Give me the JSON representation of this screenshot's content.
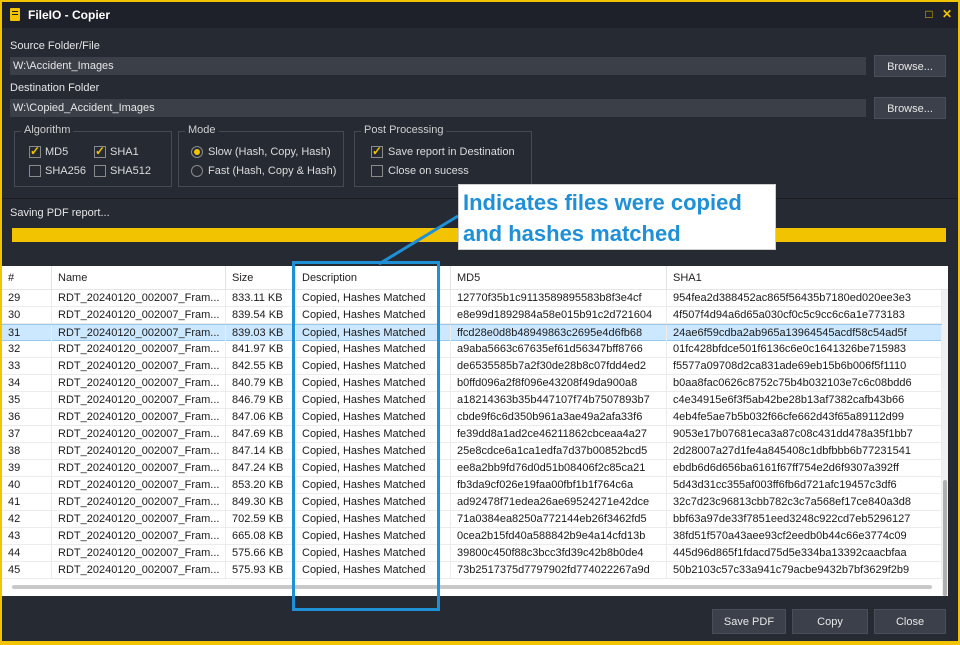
{
  "window": {
    "title": "FileIO - Copier"
  },
  "source": {
    "label": "Source Folder/File",
    "value": "W:\\Accident_Images",
    "browse_label": "Browse..."
  },
  "destination": {
    "label": "Destination Folder",
    "value": "W:\\Copied_Accident_Images",
    "browse_label": "Browse..."
  },
  "algorithm": {
    "title": "Algorithm",
    "options": [
      {
        "label": "MD5",
        "checked": true
      },
      {
        "label": "SHA1",
        "checked": true
      },
      {
        "label": "SHA256",
        "checked": false
      },
      {
        "label": "SHA512",
        "checked": false
      }
    ]
  },
  "mode": {
    "title": "Mode",
    "options": [
      {
        "label": "Slow (Hash, Copy, Hash)",
        "selected": true
      },
      {
        "label": "Fast (Hash, Copy & Hash)",
        "selected": false
      }
    ]
  },
  "post": {
    "title": "Post Processing",
    "options": [
      {
        "label": "Save report in Destination",
        "checked": true
      },
      {
        "label": "Close on sucess",
        "checked": false
      }
    ]
  },
  "status": {
    "text": "Saving PDF report...",
    "progress": 1.0
  },
  "callout": {
    "text": "Indicates files were copied and hashes matched"
  },
  "grid": {
    "columns": [
      "#",
      "Name",
      "Size",
      "Description",
      "MD5",
      "SHA1"
    ],
    "selected_row": "31",
    "rows": [
      [
        "29",
        "RDT_20240120_002007_Fram...",
        "833.11 KB",
        "Copied, Hashes Matched",
        "12770f35b1c9113589895583b8f3e4cf",
        "954fea2d388452ac865f56435b7180ed020ee3e3"
      ],
      [
        "30",
        "RDT_20240120_002007_Fram...",
        "839.54 KB",
        "Copied, Hashes Matched",
        "e8e99d1892984a58e015b91c2d721604",
        "4f507f4d94a6d65a030cf0c5c9cc6c6a1e773183"
      ],
      [
        "31",
        "RDT_20240120_002007_Fram...",
        "839.03 KB",
        "Copied, Hashes Matched",
        "ffcd28e0d8b48949863c2695e4d6fb68",
        "24ae6f59cdba2ab965a13964545acdf58c54ad5f"
      ],
      [
        "32",
        "RDT_20240120_002007_Fram...",
        "841.97 KB",
        "Copied, Hashes Matched",
        "a9aba5663c67635ef61d56347bff8766",
        "01fc428bfdce501f6136c6e0c1641326be715983"
      ],
      [
        "33",
        "RDT_20240120_002007_Fram...",
        "842.55 KB",
        "Copied, Hashes Matched",
        "de6535585b7a2f30de28b8c07fdd4ed2",
        "f5577a09708d2ca831ade69eb15b6b006f5f1110"
      ],
      [
        "34",
        "RDT_20240120_002007_Fram...",
        "840.79 KB",
        "Copied, Hashes Matched",
        "b0ffd096a2f8f096e43208f49da900a8",
        "b0aa8fac0626c8752c75b4b032103e7c6c08bdd6"
      ],
      [
        "35",
        "RDT_20240120_002007_Fram...",
        "846.79 KB",
        "Copied, Hashes Matched",
        "a18214363b35b447107f74b7507893b7",
        "c4e34915e6f3f5ab42be28b13af7382cafb43b66"
      ],
      [
        "36",
        "RDT_20240120_002007_Fram...",
        "847.06 KB",
        "Copied, Hashes Matched",
        "cbde9f6c6d350b961a3ae49a2afa33f6",
        "4eb4fe5ae7b5b032f66cfe662d43f65a89112d99"
      ],
      [
        "37",
        "RDT_20240120_002007_Fram...",
        "847.69 KB",
        "Copied, Hashes Matched",
        "fe39dd8a1ad2ce46211862cbceaa4a27",
        "9053e17b07681eca3a87c08c431dd478a35f1bb7"
      ],
      [
        "38",
        "RDT_20240120_002007_Fram...",
        "847.14 KB",
        "Copied, Hashes Matched",
        "25e8cdce6a1ca1edfa7d37b00852bcd5",
        "2d28007a27d1fe4a845408c1dbfbbb6b77231541"
      ],
      [
        "39",
        "RDT_20240120_002007_Fram...",
        "847.24 KB",
        "Copied, Hashes Matched",
        "ee8a2bb9fd76d0d51b08406f2c85ca21",
        "ebdb6d6d656ba6161f67ff754e2d6f9307a392ff"
      ],
      [
        "40",
        "RDT_20240120_002007_Fram...",
        "853.20 KB",
        "Copied, Hashes Matched",
        "fb3da9cf026e19faa00fbf1b1f764c6a",
        "5d43d31cc355af003ff6fb6d721afc19457c3df6"
      ],
      [
        "41",
        "RDT_20240120_002007_Fram...",
        "849.30 KB",
        "Copied, Hashes Matched",
        "ad92478f71edea26ae69524271e42dce",
        "32c7d23c96813cbb782c3c7a568ef17ce840a3d8"
      ],
      [
        "42",
        "RDT_20240120_002007_Fram...",
        "702.59 KB",
        "Copied, Hashes Matched",
        "71a0384ea8250a772144eb26f3462fd5",
        "bbf63a97de33f7851eed3248c922cd7eb5296127"
      ],
      [
        "43",
        "RDT_20240120_002007_Fram...",
        "665.08 KB",
        "Copied, Hashes Matched",
        "0cea2b15fd40a588842b9e4a14cfd13b",
        "38fd51f570a43aee93cf2eedb0b44c66e3774c09"
      ],
      [
        "44",
        "RDT_20240120_002007_Fram...",
        "575.66 KB",
        "Copied, Hashes Matched",
        "39800c450f88c3bcc3fd39c42b8b0de4",
        "445d96d865f1fdacd75d5e334ba13392caacbfaa"
      ],
      [
        "45",
        "RDT_20240120_002007_Fram...",
        "575.93 KB",
        "Copied, Hashes Matched",
        "73b2517375d7797902fd774022267a9d",
        "50b2103c57c33a941c79acbe9432b7bf3629f2b9"
      ]
    ]
  },
  "footer": {
    "save_pdf_label": "Save PDF",
    "copy_label": "Copy",
    "close_label": "Close"
  },
  "colors": {
    "accent": "#f2c300",
    "annotation": "#1f8fd6",
    "selection": "#cce8ff"
  }
}
